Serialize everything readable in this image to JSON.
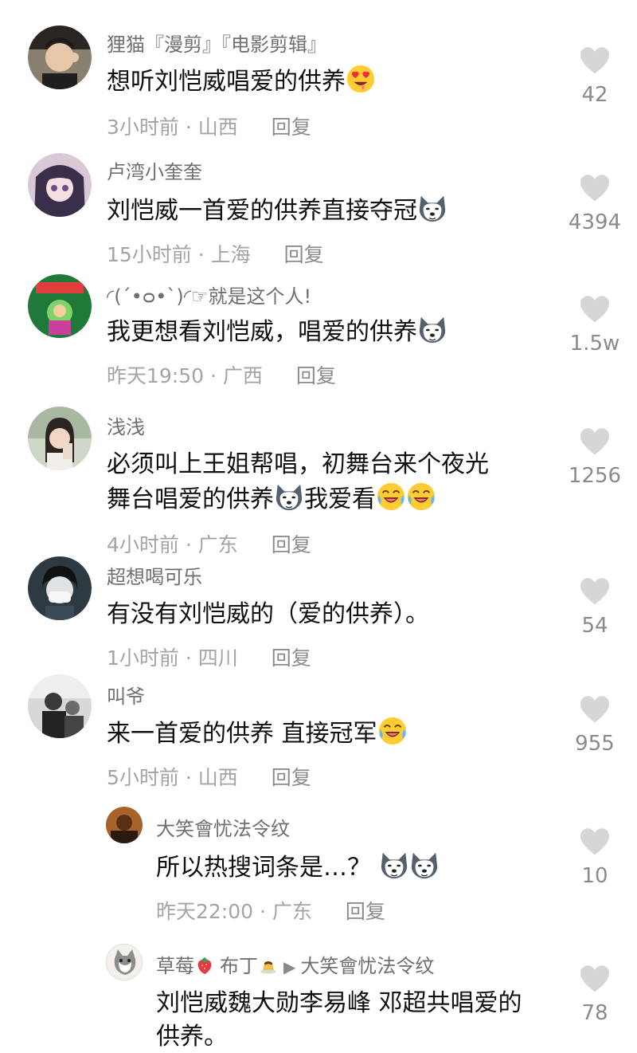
{
  "comments": [
    {
      "username": "狸猫『漫剪』『电影剪辑』",
      "text": "想听刘恺威唱爱的供养",
      "time": "3小时前",
      "location": "山西",
      "reply": "回复",
      "likes": "42"
    },
    {
      "username": "卢湾小奎奎",
      "text": "刘恺威一首爱的供养直接夺冠",
      "time": "15小时前",
      "location": "上海",
      "reply": "回复",
      "likes": "4394"
    },
    {
      "username": "◜(ˊ•ᴑ•ˋ)◜☞就是这个人!",
      "text": "我更想看刘恺威，唱爱的供养",
      "time": "昨天19:50",
      "location": "广西",
      "reply": "回复",
      "likes": "1.5w"
    },
    {
      "username": "浅浅",
      "text_line1": "必须叫上王姐帮唱，初舞台来个夜光",
      "text_line2a": "舞台唱爱的供养",
      "text_line2b": "我爱看",
      "time": "4小时前",
      "location": "广东",
      "reply": "回复",
      "likes": "1256"
    },
    {
      "username": "超想喝可乐",
      "text": "有没有刘恺威的（爱的供养）。",
      "time": "1小时前",
      "location": "四川",
      "reply": "回复",
      "likes": "54"
    },
    {
      "username": "叫爷",
      "text": "来一首爱的供养 直接冠军",
      "time": "5小时前",
      "location": "山西",
      "reply": "回复",
      "likes": "955"
    }
  ],
  "replies": [
    {
      "username": "大笑會忧法令纹",
      "text": "所以热搜词条是…？",
      "time": "昨天22:00",
      "location": "广东",
      "reply": "回复",
      "likes": "10"
    },
    {
      "username_a": "草莓",
      "username_b": "布丁",
      "reply_to": "大笑會忧法令纹",
      "text_line1": "刘恺威魏大勋李易峰 邓超共唱爱的",
      "text_line2": "供养。",
      "likes": "78"
    }
  ],
  "separator": "·",
  "icons": {
    "like": "heart-icon",
    "reply_arrow": "play-arrow-icon"
  },
  "colors": {
    "username": "#6f6f6f",
    "meta": "#a4a4a4",
    "heart": "#d6d6d6"
  }
}
